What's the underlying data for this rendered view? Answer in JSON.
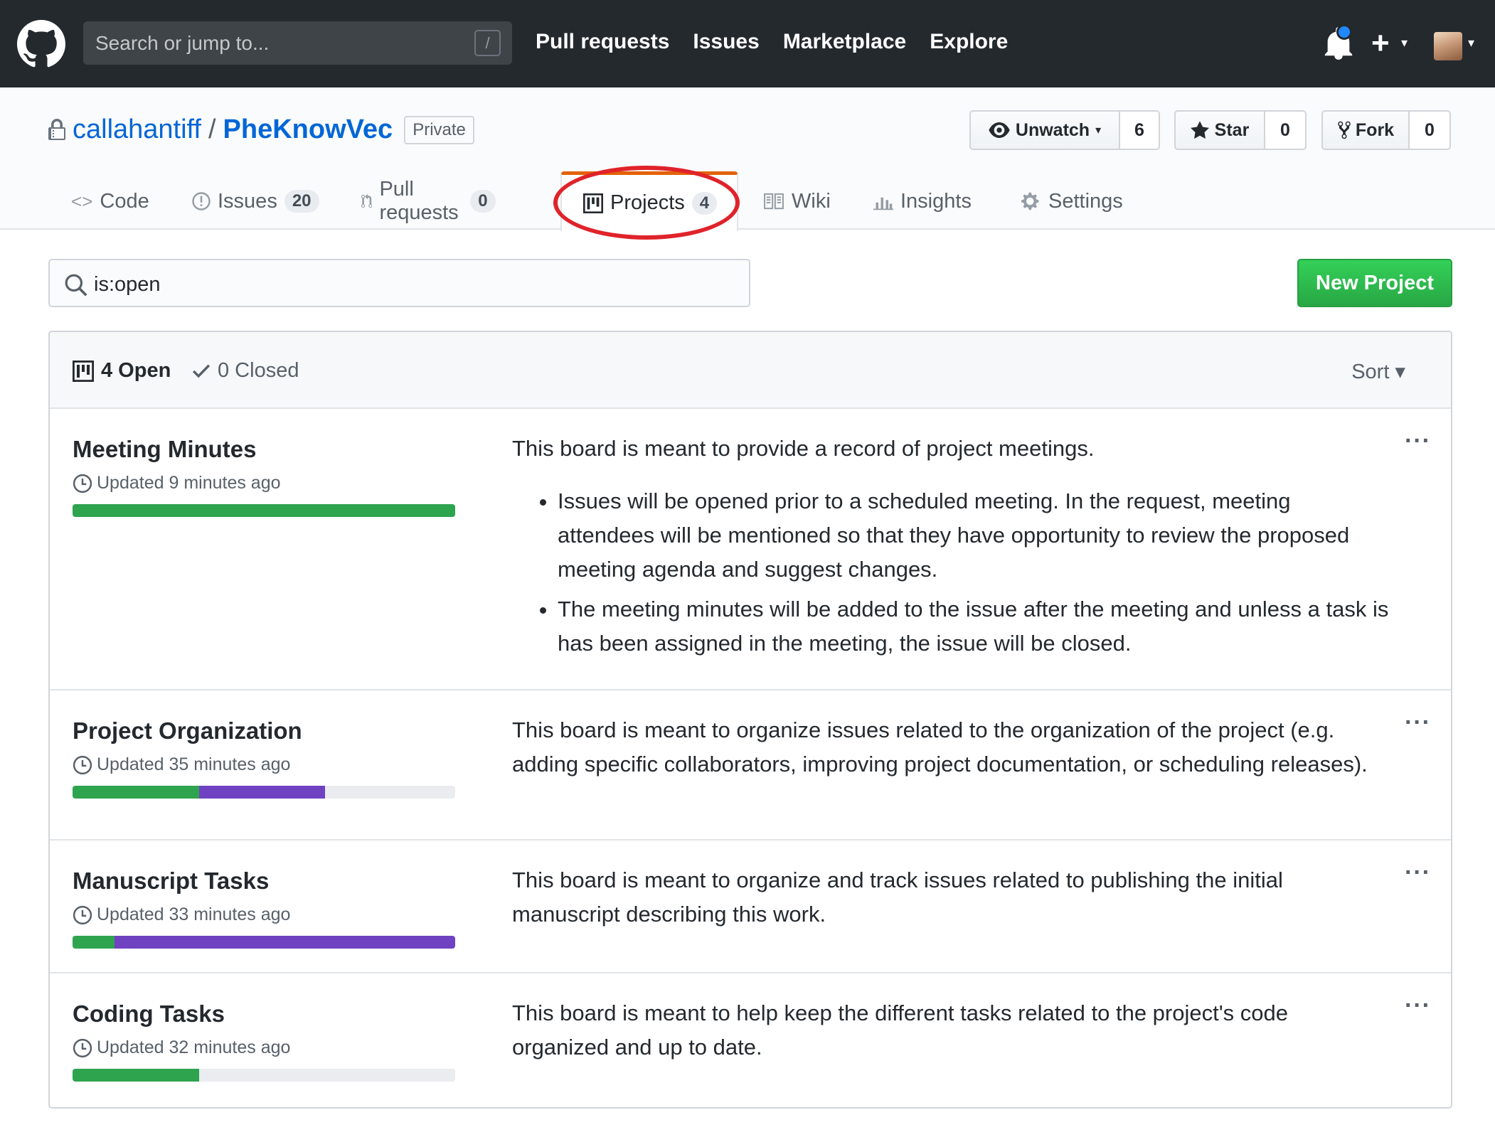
{
  "header": {
    "search_placeholder": "Search or jump to...",
    "search_shortcut": "/",
    "nav": [
      "Pull requests",
      "Issues",
      "Marketplace",
      "Explore"
    ],
    "plus": "+",
    "caret": "▾"
  },
  "repo": {
    "owner": "callahantiff",
    "separator": "/",
    "name": "PheKnowVec",
    "visibility": "Private",
    "unwatch_label": "Unwatch",
    "watch_count": "6",
    "star_label": "Star",
    "star_count": "0",
    "fork_label": "Fork",
    "fork_count": "0"
  },
  "tabs": {
    "code": "Code",
    "issues": "Issues",
    "issues_count": "20",
    "pulls": "Pull requests",
    "pulls_count": "0",
    "projects": "Projects",
    "projects_count": "4",
    "wiki": "Wiki",
    "insights": "Insights",
    "settings": "Settings"
  },
  "filter": {
    "value": "is:open",
    "new_project": "New Project"
  },
  "list": {
    "open_label": "4 Open",
    "closed_label": "0 Closed",
    "sort_label": "Sort ▾"
  },
  "projects": [
    {
      "name": "Meeting Minutes",
      "updated": "Updated 9 minutes ago",
      "done_pct": 100,
      "in_progress_pct": 0,
      "description": "This board is meant to provide a record of project meetings.",
      "bullets": [
        "Issues will be opened prior to a scheduled meeting. In the request, meeting attendees will be mentioned so that they have opportunity to review the proposed meeting agenda and suggest changes.",
        "The meeting minutes will be added to the issue after the meeting and unless a task is has been assigned in the meeting, the issue will be closed."
      ]
    },
    {
      "name": "Project Organization",
      "updated": "Updated 35 minutes ago",
      "done_pct": 33,
      "in_progress_pct": 33,
      "description": "This board is meant to organize issues related to the organization of the project (e.g. adding specific collaborators, improving project documentation, or scheduling releases)."
    },
    {
      "name": "Manuscript Tasks",
      "updated": "Updated 33 minutes ago",
      "done_pct": 11,
      "in_progress_pct": 89,
      "description": "This board is meant to organize and track issues related to publishing the initial manuscript describing this work."
    },
    {
      "name": "Coding Tasks",
      "updated": "Updated 32 minutes ago",
      "done_pct": 33,
      "in_progress_pct": 0,
      "description": "This board is meant to help keep the different tasks related to the project's code organized and up to date."
    }
  ],
  "more_label": "···",
  "colors": {
    "done": "#2ea44f",
    "in_progress": "#6f42c1",
    "todo": "#eaecef",
    "highlight": "#e0232a",
    "accent": "#0366d6"
  }
}
